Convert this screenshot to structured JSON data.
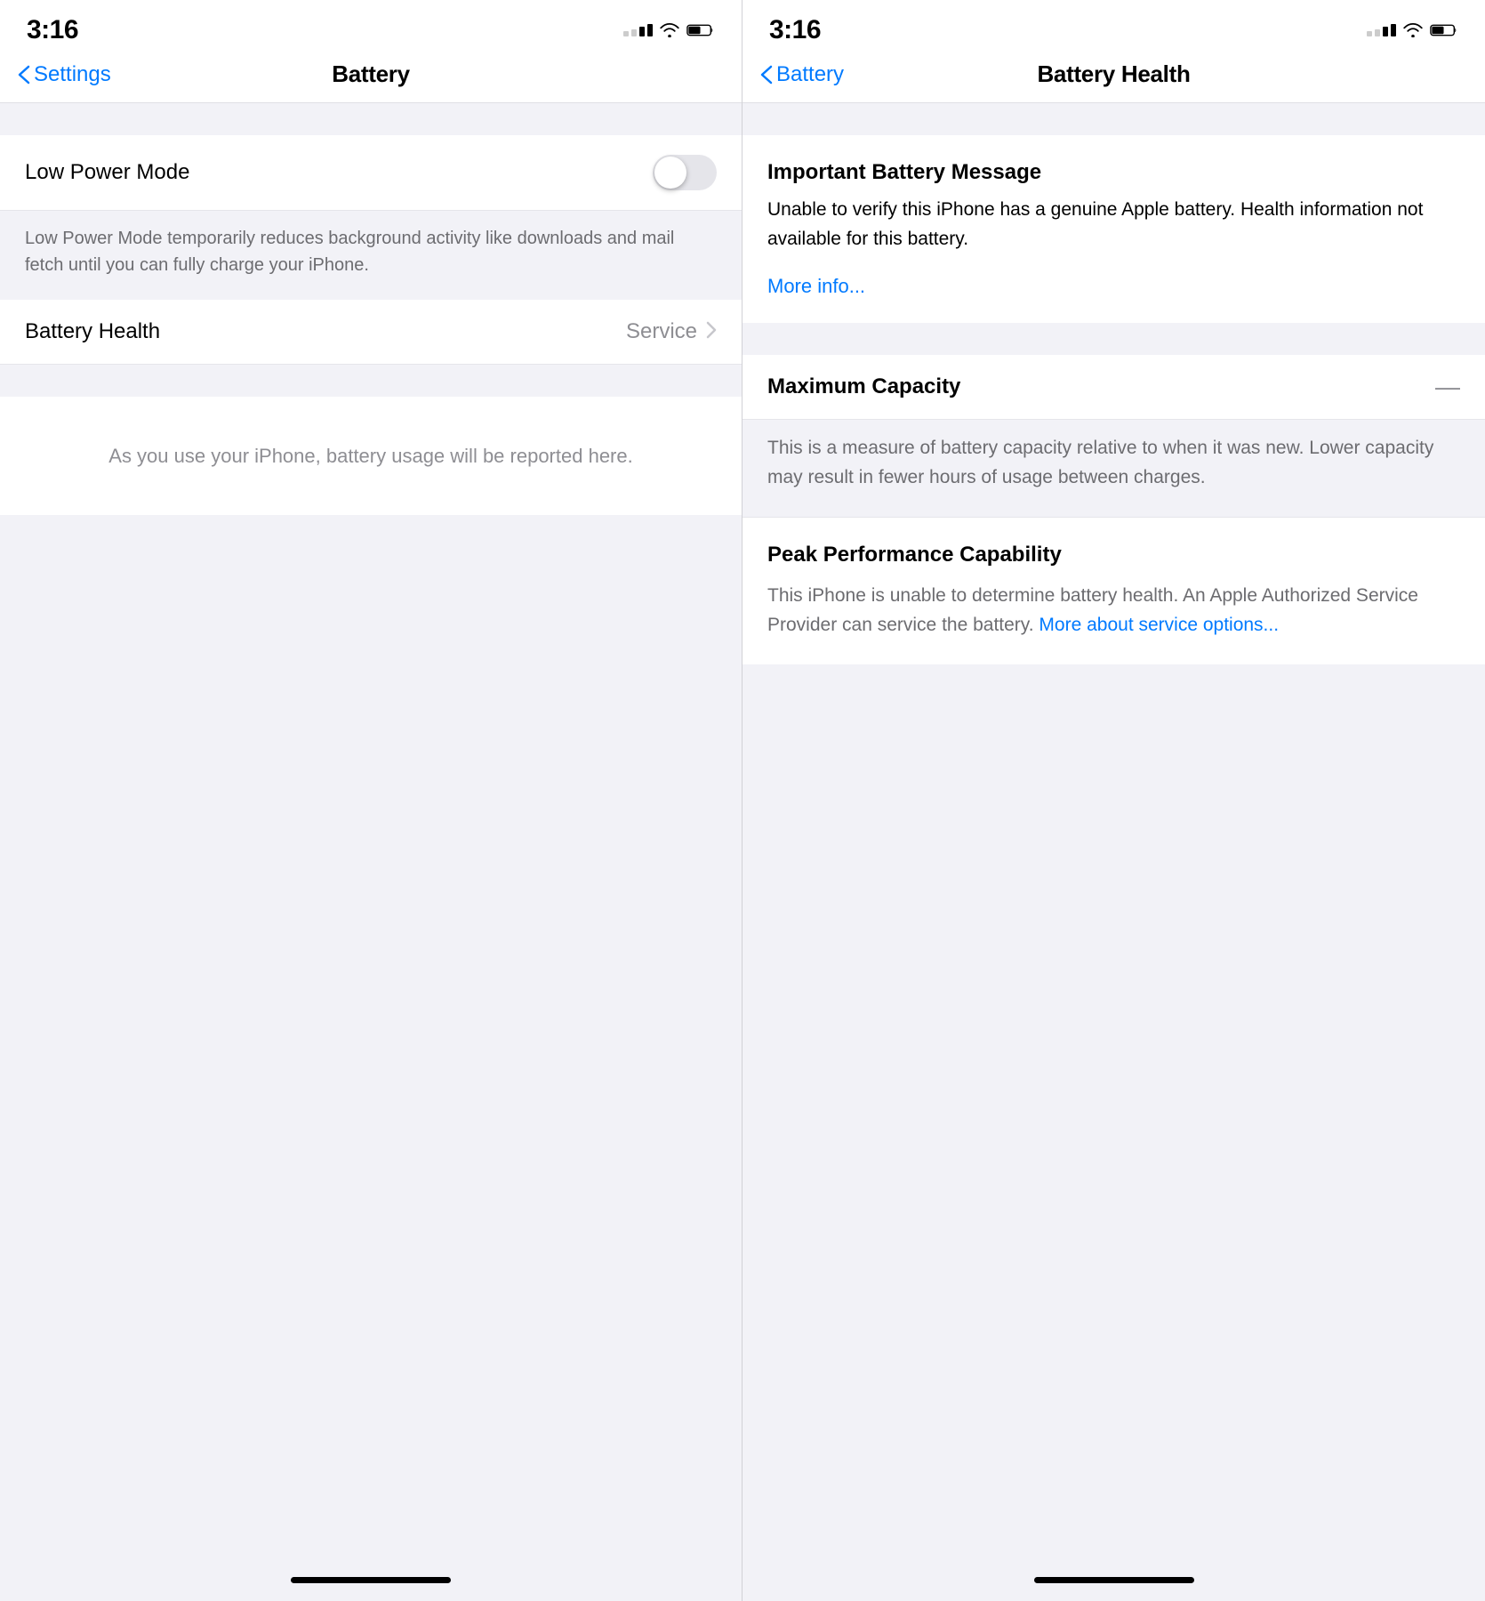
{
  "left_panel": {
    "status_bar": {
      "time": "3:16"
    },
    "nav": {
      "back_label": "Settings",
      "title": "Battery"
    },
    "low_power_mode": {
      "label": "Low Power Mode",
      "toggle_state": false,
      "description": "Low Power Mode temporarily reduces background activity like downloads and mail fetch until you can fully charge your iPhone."
    },
    "battery_health": {
      "label": "Battery Health",
      "value": "Service",
      "chevron": "›"
    },
    "empty_state": {
      "text": "As you use your iPhone, battery usage will be\nreported here."
    },
    "home_bar": "home-bar"
  },
  "right_panel": {
    "status_bar": {
      "time": "3:16"
    },
    "nav": {
      "back_label": "Battery",
      "title": "Battery Health"
    },
    "important_message": {
      "title": "Important Battery Message",
      "description": "Unable to verify this iPhone has a genuine Apple battery. Health information not available for this battery.",
      "link": "More info..."
    },
    "maximum_capacity": {
      "title": "Maximum Capacity",
      "dash": "—",
      "description": "This is a measure of battery capacity relative to when it was new. Lower capacity may result in fewer hours of usage between charges."
    },
    "peak_performance": {
      "title": "Peak Performance Capability",
      "description_part1": "This iPhone is unable to determine battery health. An Apple Authorized Service Provider can service the battery.",
      "link": "More about service options...",
      "description_part2": ""
    },
    "home_bar": "home-bar"
  }
}
